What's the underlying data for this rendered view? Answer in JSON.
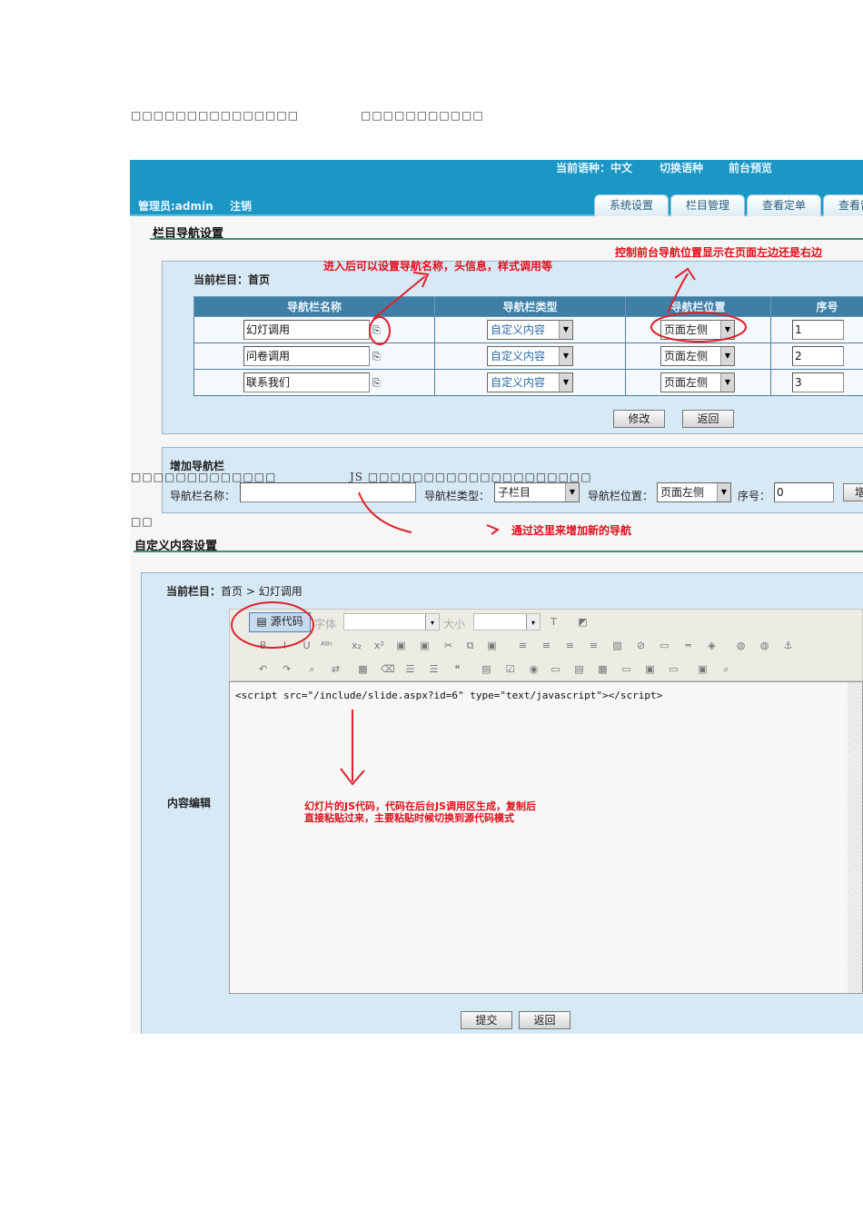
{
  "doc_text": {
    "line1_a": "□□□□□□□□□□□□□□□",
    "line1_b": "□□□□□□□□□□□",
    "line2_a": "□□□□□□□□□□□□□",
    "line2_b": "JS □□□□□□□□□□□□□□□□□□□□",
    "line3": "□□"
  },
  "header": {
    "current_language": "当前语种：中文",
    "switch_language": "切换语种",
    "preview": "前台预览",
    "admin": "管理员:admin",
    "logout": "注销",
    "tabs": [
      "系统设置",
      "栏目管理",
      "查看定单",
      "查看留言"
    ]
  },
  "nav_settings": {
    "title": "栏目导航设置",
    "current": "当前栏目：首页",
    "columns": [
      "导航栏名称",
      "导航栏类型",
      "导航栏位置",
      "序号"
    ],
    "rows": [
      {
        "name": "幻灯调用",
        "type": "自定义内容",
        "position": "页面左侧",
        "order": "1"
      },
      {
        "name": "问卷调用",
        "type": "自定义内容",
        "position": "页面左侧",
        "order": "2"
      },
      {
        "name": "联系我们",
        "type": "自定义内容",
        "position": "页面左侧",
        "order": "3"
      }
    ],
    "modify": "修改",
    "back": "返回"
  },
  "add_nav": {
    "title": "增加导航栏",
    "name_label": "导航栏名称：",
    "name_value": "",
    "type_label": "导航栏类型：",
    "type_value": "子栏目",
    "position_label": "导航栏位置：",
    "position_value": "页面左侧",
    "order_label": "序号：",
    "order_value": "0",
    "add_button": "增加"
  },
  "custom_content": {
    "title": "自定义内容设置",
    "current_label": "当前栏目：",
    "breadcrumb": [
      "首页",
      "幻灯调用"
    ],
    "separator": ">",
    "source_button": "源代码",
    "font_label": "字体",
    "size_label": "大小",
    "content_label": "内容编辑",
    "code": "<script src=\"/include/slide.aspx?id=6\" type=\"text/javascript\"></script>",
    "submit": "提交",
    "back": "返回"
  },
  "annotations": {
    "nav_name": "进入后可以设置导航名称，头信息，样式调用等",
    "nav_position": "控制前台导航位置显示在页面左边还是右边",
    "add_new": "通过这里来增加新的导航",
    "js_line1": "幻灯片的JS代码，代码在后台JS调用区生成，复制后",
    "js_line2": "直接粘贴过来，主要粘贴时候切换到源代码模式"
  },
  "colors": {
    "header": "#1b97c6",
    "table_header": "#3f7ea5",
    "panel": "#d8e9f6",
    "annotation": "#e0101a"
  }
}
